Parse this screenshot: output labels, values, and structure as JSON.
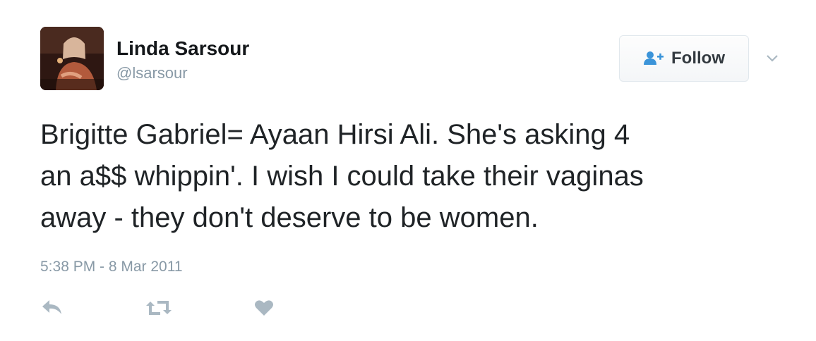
{
  "author": {
    "display_name": "Linda Sarsour",
    "handle": "@lsarsour"
  },
  "follow_button": {
    "label": "Follow",
    "icon": "add-user-icon"
  },
  "menu": {
    "icon": "chevron-down-icon"
  },
  "tweet": {
    "text_lines": [
      "Brigitte Gabriel= Ayaan Hirsi Ali. She's asking 4",
      "an a$$ whippin'. I wish I could take their vaginas",
      "away - they don't deserve to be women."
    ],
    "timestamp": "5:38 PM - 8 Mar 2011"
  },
  "actions": [
    {
      "name": "reply",
      "icon": "reply-icon"
    },
    {
      "name": "retweet",
      "icon": "retweet-icon"
    },
    {
      "name": "like",
      "icon": "heart-icon"
    }
  ],
  "colors": {
    "text": "#1f2326",
    "muted": "#8899a6",
    "follow_icon": "#3b94d9",
    "action_icons": "#aab8c2",
    "border": "#e1e8ed"
  }
}
